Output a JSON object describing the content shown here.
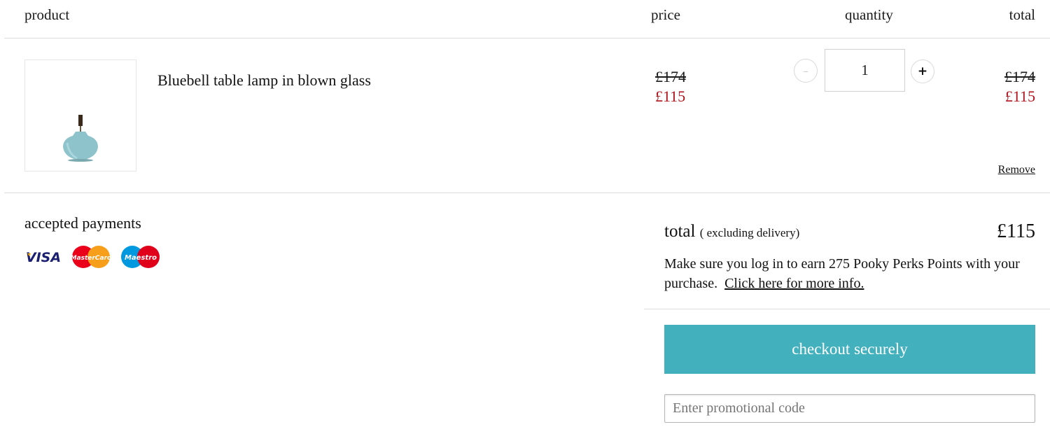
{
  "header": {
    "product": "product",
    "price": "price",
    "quantity": "quantity",
    "total": "total"
  },
  "cart": {
    "item": {
      "name": "Bluebell table lamp in blown glass",
      "image_alt": "Bluebell table lamp",
      "price_old": "£174",
      "price_new": "£115",
      "quantity": "1",
      "decrement_label": "–",
      "increment_label": "+",
      "total_old": "£174",
      "total_new": "£115",
      "remove_label": "Remove"
    }
  },
  "payments": {
    "title": "accepted payments",
    "cards": [
      {
        "name": "VISA",
        "icon": "visa-icon"
      },
      {
        "name": "MasterCard",
        "icon": "mastercard-icon"
      },
      {
        "name": "Maestro",
        "icon": "maestro-icon"
      }
    ]
  },
  "summary": {
    "total_label": "total",
    "total_sub": "( excluding delivery)",
    "total_value": "£115",
    "perks_text": "Make sure you log in to earn 275 Pooky Perks Points with your purchase.",
    "perks_link": "Click here for more info.",
    "checkout_label": "checkout securely",
    "promo_placeholder": "Enter promotional code"
  },
  "colors": {
    "accent": "#42b0bd",
    "sale": "#b0121b",
    "visa": "#1a1f71",
    "mastercard_red": "#eb001b",
    "mastercard_yellow": "#f79e1b",
    "maestro_blue": "#0099df"
  }
}
